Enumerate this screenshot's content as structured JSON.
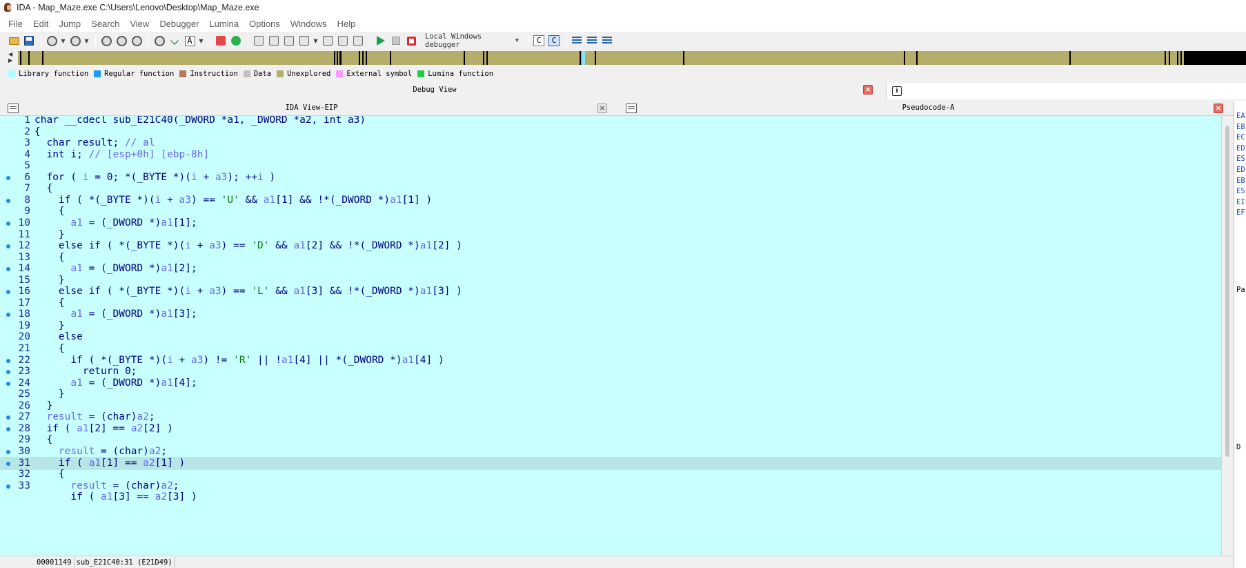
{
  "window": {
    "title": "IDA - Map_Maze.exe C:\\Users\\Lenovo\\Desktop\\Map_Maze.exe"
  },
  "menu": [
    "File",
    "Edit",
    "Jump",
    "Search",
    "View",
    "Debugger",
    "Lumina",
    "Options",
    "Windows",
    "Help"
  ],
  "toolbar": {
    "debugger_select": "Local Windows debugger",
    "c_button_1": "C",
    "c_button_2": "C"
  },
  "legend": [
    {
      "label": "Library function",
      "color": "#aaffff"
    },
    {
      "label": "Regular function",
      "color": "#1e9bf0"
    },
    {
      "label": "Instruction",
      "color": "#b97a57"
    },
    {
      "label": "Data",
      "color": "#c0c0c0"
    },
    {
      "label": "Unexplored",
      "color": "#b5ae6b"
    },
    {
      "label": "External symbol",
      "color": "#ff99ff"
    },
    {
      "label": "Lumina function",
      "color": "#22cc44"
    }
  ],
  "debug_view": {
    "title": "Debug View"
  },
  "panes": {
    "left_title": "IDA View-EIP",
    "right_title": "Pseudocode-A"
  },
  "code": {
    "current_line": 31,
    "lines": [
      {
        "n": "1",
        "bp": false,
        "tokens": [
          [
            "kw",
            "char __cdecl sub_E21C40(_DWORD *a1, _DWORD *a2, int a3)"
          ]
        ]
      },
      {
        "n": "2",
        "bp": false,
        "tokens": [
          [
            "kw",
            "{"
          ]
        ]
      },
      {
        "n": "3",
        "bp": false,
        "tokens": [
          [
            "kw",
            "  char result; "
          ],
          [
            "cmt",
            "// al"
          ]
        ]
      },
      {
        "n": "4",
        "bp": false,
        "tokens": [
          [
            "kw",
            "  int i; "
          ],
          [
            "cmt",
            "// [esp+0h] [ebp-8h]"
          ]
        ]
      },
      {
        "n": "5",
        "bp": false,
        "tokens": [
          [
            "kw",
            ""
          ]
        ]
      },
      {
        "n": "6",
        "bp": true,
        "tokens": [
          [
            "kw",
            "  for ( "
          ],
          [
            "var",
            "i"
          ],
          [
            "kw",
            " = 0; *(_BYTE *)("
          ],
          [
            "var",
            "i"
          ],
          [
            "kw",
            " + "
          ],
          [
            "var",
            "a3"
          ],
          [
            "kw",
            "); ++"
          ],
          [
            "var",
            "i"
          ],
          [
            "kw",
            " )"
          ]
        ]
      },
      {
        "n": "7",
        "bp": false,
        "tokens": [
          [
            "kw",
            "  {"
          ]
        ]
      },
      {
        "n": "8",
        "bp": true,
        "tokens": [
          [
            "kw",
            "    if ( *(_BYTE *)("
          ],
          [
            "var",
            "i"
          ],
          [
            "kw",
            " + "
          ],
          [
            "var",
            "a3"
          ],
          [
            "kw",
            ") == "
          ],
          [
            "str",
            "'U'"
          ],
          [
            "kw",
            " && "
          ],
          [
            "var",
            "a1"
          ],
          [
            "kw",
            "[1] && !*(_DWORD *)"
          ],
          [
            "var",
            "a1"
          ],
          [
            "kw",
            "[1] )"
          ]
        ]
      },
      {
        "n": "9",
        "bp": false,
        "tokens": [
          [
            "kw",
            "    {"
          ]
        ]
      },
      {
        "n": "10",
        "bp": true,
        "tokens": [
          [
            "kw",
            "      "
          ],
          [
            "var",
            "a1"
          ],
          [
            "kw",
            " = (_DWORD *)"
          ],
          [
            "var",
            "a1"
          ],
          [
            "kw",
            "[1];"
          ]
        ]
      },
      {
        "n": "11",
        "bp": false,
        "tokens": [
          [
            "kw",
            "    }"
          ]
        ]
      },
      {
        "n": "12",
        "bp": true,
        "tokens": [
          [
            "kw",
            "    else if ( *(_BYTE *)("
          ],
          [
            "var",
            "i"
          ],
          [
            "kw",
            " + "
          ],
          [
            "var",
            "a3"
          ],
          [
            "kw",
            ") == "
          ],
          [
            "str",
            "'D'"
          ],
          [
            "kw",
            " && "
          ],
          [
            "var",
            "a1"
          ],
          [
            "kw",
            "[2] && !*(_DWORD *)"
          ],
          [
            "var",
            "a1"
          ],
          [
            "kw",
            "[2] )"
          ]
        ]
      },
      {
        "n": "13",
        "bp": false,
        "tokens": [
          [
            "kw",
            "    {"
          ]
        ]
      },
      {
        "n": "14",
        "bp": true,
        "tokens": [
          [
            "kw",
            "      "
          ],
          [
            "var",
            "a1"
          ],
          [
            "kw",
            " = (_DWORD *)"
          ],
          [
            "var",
            "a1"
          ],
          [
            "kw",
            "[2];"
          ]
        ]
      },
      {
        "n": "15",
        "bp": false,
        "tokens": [
          [
            "kw",
            "    }"
          ]
        ]
      },
      {
        "n": "16",
        "bp": true,
        "tokens": [
          [
            "kw",
            "    else if ( *(_BYTE *)("
          ],
          [
            "var",
            "i"
          ],
          [
            "kw",
            " + "
          ],
          [
            "var",
            "a3"
          ],
          [
            "kw",
            ") == "
          ],
          [
            "str",
            "'L'"
          ],
          [
            "kw",
            " && "
          ],
          [
            "var",
            "a1"
          ],
          [
            "kw",
            "[3] && !*(_DWORD *)"
          ],
          [
            "var",
            "a1"
          ],
          [
            "kw",
            "[3] )"
          ]
        ]
      },
      {
        "n": "17",
        "bp": false,
        "tokens": [
          [
            "kw",
            "    {"
          ]
        ]
      },
      {
        "n": "18",
        "bp": true,
        "tokens": [
          [
            "kw",
            "      "
          ],
          [
            "var",
            "a1"
          ],
          [
            "kw",
            " = (_DWORD *)"
          ],
          [
            "var",
            "a1"
          ],
          [
            "kw",
            "[3];"
          ]
        ]
      },
      {
        "n": "19",
        "bp": false,
        "tokens": [
          [
            "kw",
            "    }"
          ]
        ]
      },
      {
        "n": "20",
        "bp": false,
        "tokens": [
          [
            "kw",
            "    else"
          ]
        ]
      },
      {
        "n": "21",
        "bp": false,
        "tokens": [
          [
            "kw",
            "    {"
          ]
        ]
      },
      {
        "n": "22",
        "bp": true,
        "tokens": [
          [
            "kw",
            "      if ( *(_BYTE *)("
          ],
          [
            "var",
            "i"
          ],
          [
            "kw",
            " + "
          ],
          [
            "var",
            "a3"
          ],
          [
            "kw",
            ") != "
          ],
          [
            "str",
            "'R'"
          ],
          [
            "kw",
            " || !"
          ],
          [
            "var",
            "a1"
          ],
          [
            "kw",
            "[4] || *(_DWORD *)"
          ],
          [
            "var",
            "a1"
          ],
          [
            "kw",
            "[4] )"
          ]
        ]
      },
      {
        "n": "23",
        "bp": true,
        "tokens": [
          [
            "kw",
            "        return 0;"
          ]
        ]
      },
      {
        "n": "24",
        "bp": true,
        "tokens": [
          [
            "kw",
            "      "
          ],
          [
            "var",
            "a1"
          ],
          [
            "kw",
            " = (_DWORD *)"
          ],
          [
            "var",
            "a1"
          ],
          [
            "kw",
            "[4];"
          ]
        ]
      },
      {
        "n": "25",
        "bp": false,
        "tokens": [
          [
            "kw",
            "    }"
          ]
        ]
      },
      {
        "n": "26",
        "bp": false,
        "tokens": [
          [
            "kw",
            "  }"
          ]
        ]
      },
      {
        "n": "27",
        "bp": true,
        "tokens": [
          [
            "kw",
            "  "
          ],
          [
            "var",
            "result"
          ],
          [
            "kw",
            " = (char)"
          ],
          [
            "var",
            "a2"
          ],
          [
            "kw",
            ";"
          ]
        ]
      },
      {
        "n": "28",
        "bp": true,
        "tokens": [
          [
            "kw",
            "  if ( "
          ],
          [
            "var",
            "a1"
          ],
          [
            "kw",
            "[2] == "
          ],
          [
            "var",
            "a2"
          ],
          [
            "kw",
            "[2] )"
          ]
        ]
      },
      {
        "n": "29",
        "bp": false,
        "tokens": [
          [
            "kw",
            "  {"
          ]
        ]
      },
      {
        "n": "30",
        "bp": true,
        "tokens": [
          [
            "kw",
            "    "
          ],
          [
            "var",
            "result"
          ],
          [
            "kw",
            " = (char)"
          ],
          [
            "var",
            "a2"
          ],
          [
            "kw",
            ";"
          ]
        ]
      },
      {
        "n": "31",
        "bp": true,
        "tokens": [
          [
            "kw",
            "    if ( "
          ],
          [
            "var",
            "a1"
          ],
          [
            "kw",
            "[1] == "
          ],
          [
            "var",
            "a2"
          ],
          [
            "kw",
            "[1] )"
          ]
        ]
      },
      {
        "n": "32",
        "bp": false,
        "tokens": [
          [
            "kw",
            "    {"
          ]
        ]
      },
      {
        "n": "33",
        "bp": true,
        "tokens": [
          [
            "kw",
            "      "
          ],
          [
            "var",
            "result"
          ],
          [
            "kw",
            " = (char)"
          ],
          [
            "var",
            "a2"
          ],
          [
            "kw",
            ";"
          ]
        ]
      },
      {
        "n": "",
        "bp": false,
        "tokens": [
          [
            "kw",
            "      if ( "
          ],
          [
            "var",
            "a1"
          ],
          [
            "kw",
            "[3] == "
          ],
          [
            "var",
            "a2"
          ],
          [
            "kw",
            "[3] )"
          ]
        ]
      }
    ]
  },
  "side_registers": [
    "EA",
    "EB",
    "EC",
    "ED",
    "ES",
    "ED",
    "EB",
    "ES",
    "EI",
    "EF"
  ],
  "side_labels": [
    "Pa",
    "D"
  ],
  "status": {
    "offset": "00001149",
    "location": "sub_E21C40:31 (E21D49)"
  }
}
